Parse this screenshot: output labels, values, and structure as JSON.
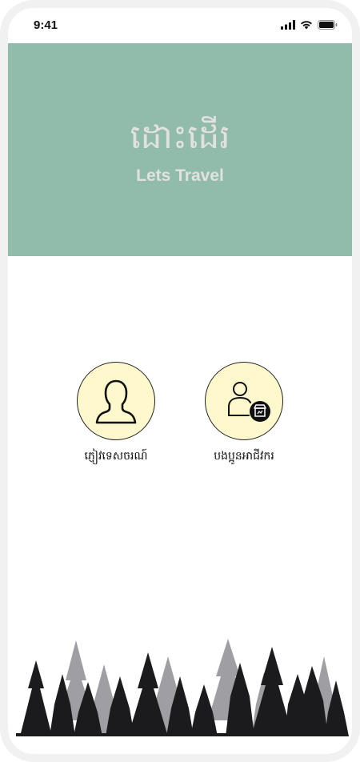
{
  "status_bar": {
    "time": "9:41",
    "icons": [
      "cellular-signal-icon",
      "wifi-icon",
      "battery-icon"
    ]
  },
  "hero": {
    "title_khmer": "ដោះដើរ",
    "title_english": "Lets Travel",
    "background_color": "#91bcab"
  },
  "roles": [
    {
      "label": "ភ្ញៀវទេសចរណ៍",
      "icon": "person-silhouette-icon"
    },
    {
      "label": "បងប្អូនអាជីវករ",
      "icon": "person-with-shop-icon"
    }
  ],
  "colors": {
    "role_circle_fill": "#fef8cc",
    "forest_dark": "#1b1b1d",
    "forest_light": "#9e9ea3"
  },
  "decoration": {
    "footer_image": "pine-forest-silhouette"
  }
}
